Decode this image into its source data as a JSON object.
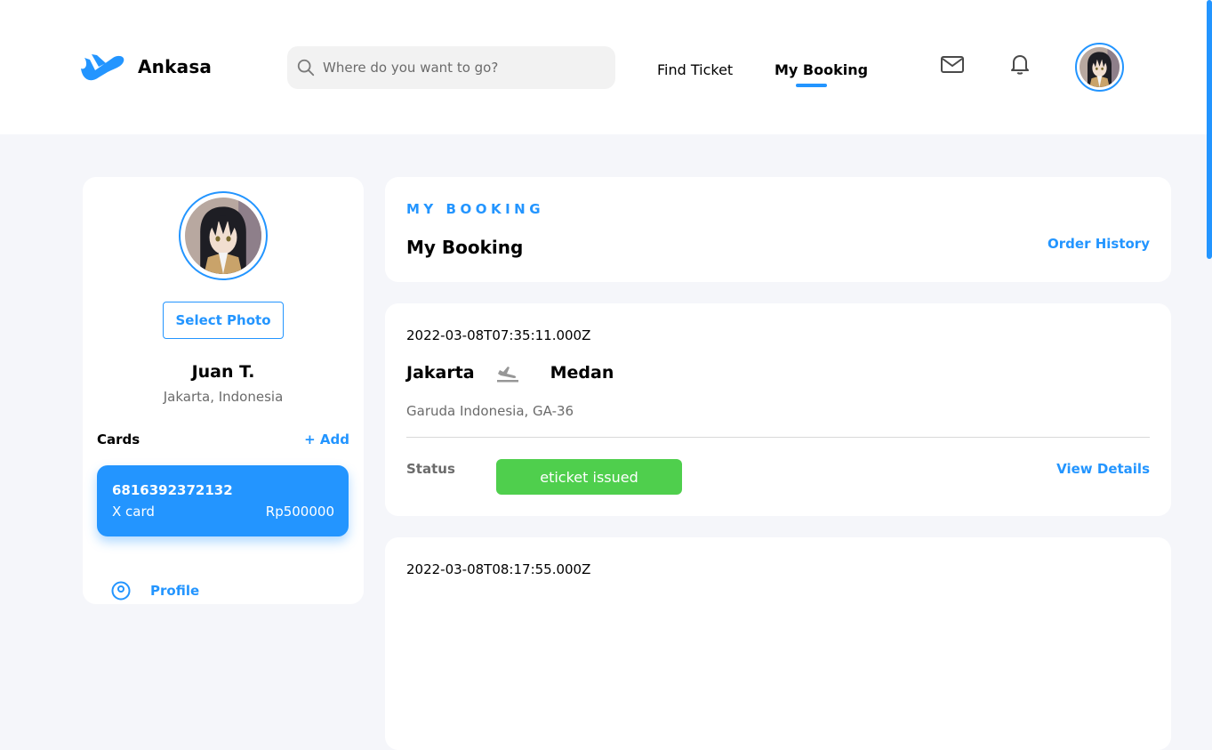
{
  "brand": {
    "name": "Ankasa",
    "accent": "#2395FF"
  },
  "search": {
    "placeholder": "Where do you want to go?",
    "value": ""
  },
  "nav": {
    "find_ticket": "Find Ticket",
    "my_booking": "My Booking",
    "active": "my_booking"
  },
  "header_icons": [
    "mail-icon",
    "bell-icon",
    "avatar"
  ],
  "profile": {
    "select_photo": "Select Photo",
    "name": "Juan T.",
    "location": "Jakarta, Indonesia",
    "cards_label": "Cards",
    "add_label": "+ Add",
    "card": {
      "number": "6816392372132",
      "type": "X card",
      "balance": "Rp500000"
    },
    "menu": [
      {
        "label": "Profile",
        "icon": "user-circle-icon"
      }
    ]
  },
  "main": {
    "eyebrow": "MY BOOKING",
    "title": "My Booking",
    "order_history": "Order History"
  },
  "bookings": [
    {
      "date": "2022-03-08T07:35:11.000Z",
      "from": "Jakarta",
      "to": "Medan",
      "airline": "Garuda Indonesia, GA-36",
      "status_label": "Status",
      "status": "eticket issued",
      "status_color": "#4FCF4D",
      "details_label": "View Details"
    },
    {
      "date": "2022-03-08T08:17:55.000Z"
    }
  ]
}
